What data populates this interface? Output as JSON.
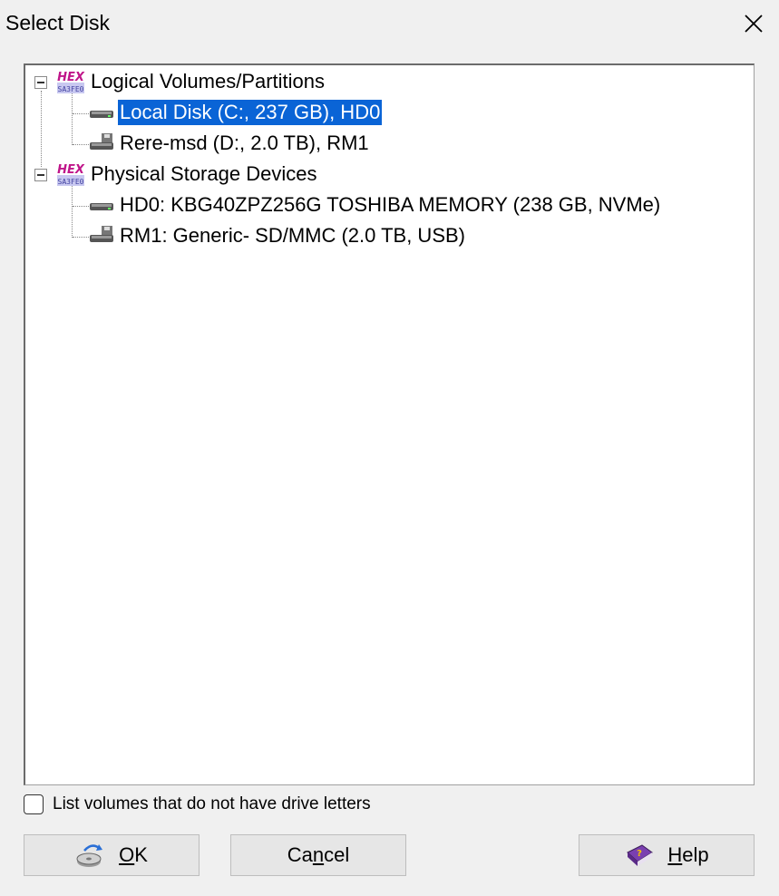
{
  "window": {
    "title": "Select Disk"
  },
  "tree": {
    "groups": [
      {
        "label": "Logical Volumes/Partitions",
        "icon": "hex-logo-icon",
        "expanded": true,
        "items": [
          {
            "label": "Local Disk (C:, 237 GB), HD0",
            "icon": "hard-disk-icon",
            "selected": true
          },
          {
            "label": "Rere-msd (D:, 2.0 TB), RM1",
            "icon": "removable-disk-icon",
            "selected": false
          }
        ]
      },
      {
        "label": "Physical Storage Devices",
        "icon": "hex-logo-icon",
        "expanded": true,
        "items": [
          {
            "label": "HD0: KBG40ZPZ256G TOSHIBA MEMORY (238 GB, NVMe)",
            "icon": "hard-disk-icon",
            "selected": false
          },
          {
            "label": "RM1: Generic- SD/MMC (2.0 TB, USB)",
            "icon": "removable-disk-icon",
            "selected": false
          }
        ]
      }
    ],
    "hex_icon_text_top": "HEX",
    "hex_icon_text_bottom": "SA3FE0"
  },
  "options": {
    "no_letter_volumes_label": "List volumes that do not have drive letters",
    "no_letter_volumes_checked": false
  },
  "buttons": {
    "ok": {
      "mnemonic": "O",
      "rest": "K"
    },
    "cancel": {
      "pre": "Ca",
      "mnemonic": "n",
      "rest": "cel"
    },
    "help": {
      "mnemonic": "H",
      "rest": "elp"
    }
  },
  "colors": {
    "selection": "#0a64d6",
    "background": "#f0f0f0"
  }
}
